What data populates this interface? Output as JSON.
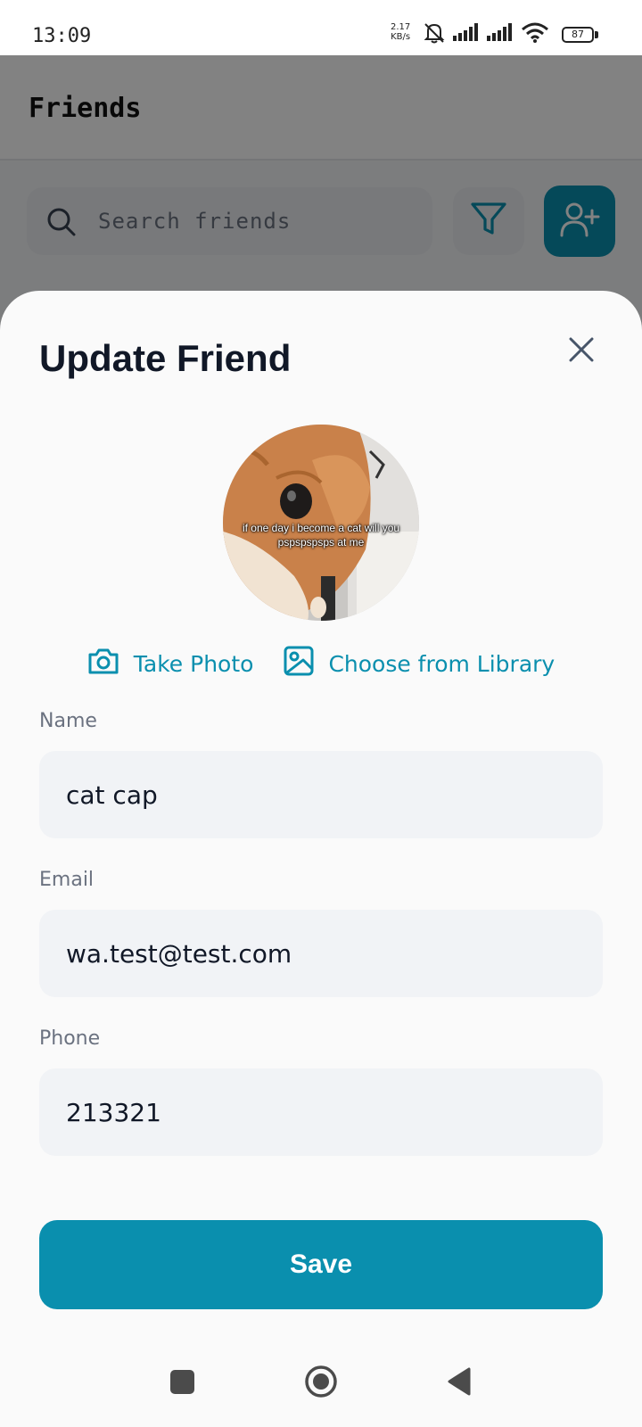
{
  "status_bar": {
    "time": "13:09",
    "net_speed_value": "2.17",
    "net_speed_unit": "KB/s",
    "battery": "87",
    "icons": [
      "bell-muted-icon",
      "signal-icon",
      "signal-icon",
      "wifi-icon",
      "battery-icon"
    ]
  },
  "background_page": {
    "title": "Friends",
    "search_placeholder": "Search friends",
    "icons": [
      "search-icon",
      "filter-icon",
      "add-user-icon"
    ]
  },
  "sheet": {
    "title": "Update Friend",
    "avatar_caption": "if one day i become a cat will you pspspspsps at me",
    "take_photo_label": "Take Photo",
    "choose_library_label": "Choose from Library",
    "fields": {
      "name_label": "Name",
      "name_value": "cat cap",
      "email_label": "Email",
      "email_value": "wa.test@test.com",
      "phone_label": "Phone",
      "phone_value": "213321"
    },
    "save_label": "Save"
  },
  "colors": {
    "accent": "#0a8fae",
    "title_text": "#111827",
    "label_text": "#6b7280",
    "field_bg": "#f1f3f6"
  }
}
